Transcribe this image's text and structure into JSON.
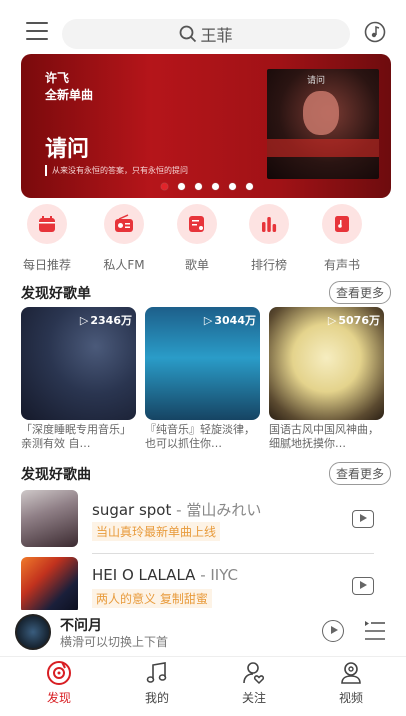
{
  "search": {
    "query": "王菲"
  },
  "banner": {
    "artist": "许飞",
    "subtitle": "全新单曲",
    "title": "请问",
    "description": "从来没有永恒的答案，只有永恒的提问",
    "cover_text": "请问",
    "total_dots": 6,
    "active_dot": 0
  },
  "quick_links": [
    {
      "label": "每日推荐",
      "icon": "calendar-icon"
    },
    {
      "label": "私人FM",
      "icon": "radio-icon"
    },
    {
      "label": "歌单",
      "icon": "playlist-icon"
    },
    {
      "label": "排行榜",
      "icon": "chart-icon"
    },
    {
      "label": "有声书",
      "icon": "book-icon"
    }
  ],
  "section_playlists": {
    "title": "发现好歌单",
    "more": "查看更多"
  },
  "playlists": [
    {
      "count": "2346万",
      "text": "「深度睡眠专用音乐」亲测有效 自…"
    },
    {
      "count": "3044万",
      "text": "『纯音乐』轻旋淡律，也可以抓住你…"
    },
    {
      "count": "5076万",
      "text": "国语古风中国风神曲，细腻地抚摸你…"
    }
  ],
  "section_songs": {
    "title": "发现好歌曲",
    "more": "查看更多"
  },
  "songs": [
    {
      "title": "sugar spot",
      "artist": " - 當山みれい",
      "tag": "当山真玲最新单曲上线"
    },
    {
      "title": "HEI O LALALA",
      "artist": " - IIYC",
      "tag": "两人的意义 复制甜蜜"
    }
  ],
  "player": {
    "name": "不问月",
    "hint": "横滑可以切换上下首"
  },
  "tabs": [
    {
      "label": "发现",
      "icon": "discover-icon",
      "active": true
    },
    {
      "label": "我的",
      "icon": "music-note-icon",
      "active": false
    },
    {
      "label": "关注",
      "icon": "follow-icon",
      "active": false
    },
    {
      "label": "视频",
      "icon": "video-icon",
      "active": false
    }
  ],
  "colors": {
    "accent": "#d81e23",
    "icon_bg": "#fde3e2",
    "tag_text": "#e89b3c"
  }
}
